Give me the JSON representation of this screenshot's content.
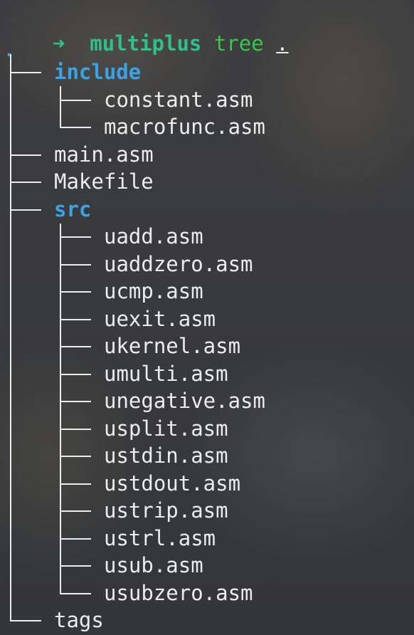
{
  "prompt": {
    "arrow": "➜",
    "directory": "multiplus",
    "command": "tree",
    "argument": "."
  },
  "tree": {
    "root": ".",
    "entries": [
      {
        "name": "include",
        "type": "dir",
        "depth": 0
      },
      {
        "name": "constant.asm",
        "type": "file",
        "depth": 1
      },
      {
        "name": "macrofunc.asm",
        "type": "file",
        "depth": 1
      },
      {
        "name": "main.asm",
        "type": "file",
        "depth": 0
      },
      {
        "name": "Makefile",
        "type": "file",
        "depth": 0
      },
      {
        "name": "src",
        "type": "dir",
        "depth": 0
      },
      {
        "name": "uadd.asm",
        "type": "file",
        "depth": 1
      },
      {
        "name": "uaddzero.asm",
        "type": "file",
        "depth": 1
      },
      {
        "name": "ucmp.asm",
        "type": "file",
        "depth": 1
      },
      {
        "name": "uexit.asm",
        "type": "file",
        "depth": 1
      },
      {
        "name": "ukernel.asm",
        "type": "file",
        "depth": 1
      },
      {
        "name": "umulti.asm",
        "type": "file",
        "depth": 1
      },
      {
        "name": "unegative.asm",
        "type": "file",
        "depth": 1
      },
      {
        "name": "usplit.asm",
        "type": "file",
        "depth": 1
      },
      {
        "name": "ustdin.asm",
        "type": "file",
        "depth": 1
      },
      {
        "name": "ustdout.asm",
        "type": "file",
        "depth": 1
      },
      {
        "name": "ustrip.asm",
        "type": "file",
        "depth": 1
      },
      {
        "name": "ustrl.asm",
        "type": "file",
        "depth": 1
      },
      {
        "name": "usub.asm",
        "type": "file",
        "depth": 1
      },
      {
        "name": "usubzero.asm",
        "type": "file",
        "depth": 1
      },
      {
        "name": "tags",
        "type": "file",
        "depth": 0
      }
    ]
  },
  "colors": {
    "background": "#3a3b3e",
    "foreground": "#ececec",
    "directory": "#3aa3e3",
    "prompt": "#2fbf8f",
    "command": "#35c94a"
  }
}
